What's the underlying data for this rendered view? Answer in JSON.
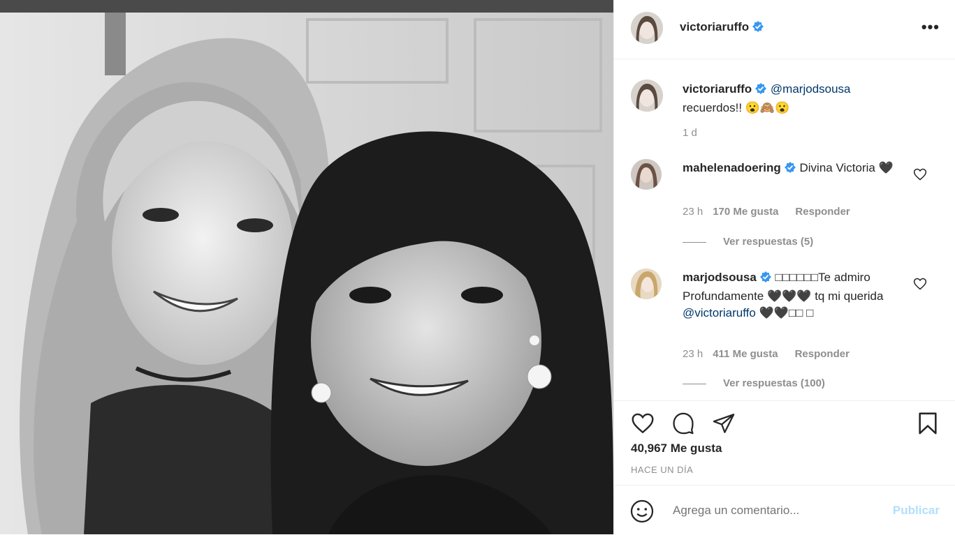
{
  "post": {
    "author": "victoriaruffo",
    "more_label": "•••"
  },
  "caption": {
    "author": "victoriaruffo",
    "mention": "@marjodsousa",
    "text": "recuerdos!! 😮🙈😮",
    "age": "1 d"
  },
  "comments": [
    {
      "author": "mahelenadoering",
      "text": "Divina Victoria 🖤",
      "age": "23 h",
      "likes": "170 Me gusta",
      "reply_label": "Responder",
      "view_replies": "Ver respuestas (5)"
    },
    {
      "author": "marjodsousa",
      "text_before": "□□□□□□Te admiro Profundamente 🖤🖤🖤 tq mi querida",
      "mention": "@victoriaruffo",
      "text_after": "🖤🖤□□ □",
      "age": "23 h",
      "likes": "411 Me gusta",
      "reply_label": "Responder",
      "view_replies": "Ver respuestas (100)"
    }
  ],
  "stats": {
    "likes": "40,967 Me gusta",
    "posted": "HACE UN DÍA"
  },
  "comment_box": {
    "placeholder": "Agrega un comentario...",
    "publish_label": "Publicar"
  },
  "colors": {
    "verified": "#3897f0",
    "link": "#00376b",
    "muted": "#8e8e8e",
    "publish_disabled": "#b2dffc"
  },
  "icons": [
    "verified-badge-icon",
    "more-options-icon",
    "heart-icon",
    "comment-icon",
    "share-icon",
    "bookmark-icon",
    "emoji-icon"
  ]
}
